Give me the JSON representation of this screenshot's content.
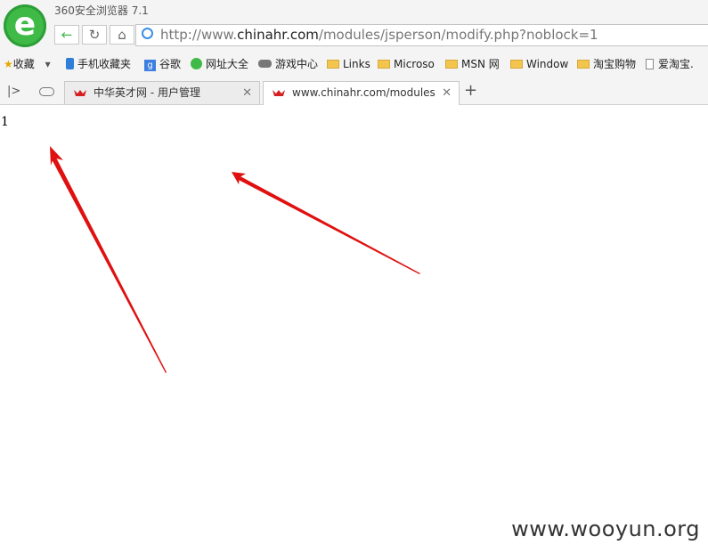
{
  "browser": {
    "title": "360安全浏览器 7.1"
  },
  "nav": {
    "back": "←",
    "reload": "↻",
    "home": "⌂"
  },
  "urlbar": {
    "host_pre": "http://www.",
    "host": "chinahr.com",
    "path": "/modules/jsperson/modify.php?noblock=1"
  },
  "bookmarks": [
    {
      "label": "收藏",
      "icon": "star-icon"
    },
    {
      "label": "手机收藏夹",
      "icon": "phone-icon"
    },
    {
      "label": "谷歌",
      "icon": "google-icon"
    },
    {
      "label": "网址大全",
      "icon": "globe-icon"
    },
    {
      "label": "游戏中心",
      "icon": "gamepad-icon"
    },
    {
      "label": "Links",
      "icon": "folder-icon"
    },
    {
      "label": "Microso",
      "icon": "folder-icon"
    },
    {
      "label": "MSN 网",
      "icon": "folder-icon"
    },
    {
      "label": "Window",
      "icon": "folder-icon"
    },
    {
      "label": "淘宝购物",
      "icon": "folder-icon"
    },
    {
      "label": "爱淘宝.",
      "icon": "page-icon"
    }
  ],
  "tabs": [
    {
      "label": "中华英才网 - 用户管理",
      "active": false
    },
    {
      "label": "www.chinahr.com/modules/js",
      "active": true
    }
  ],
  "tab_new": "+",
  "page": {
    "text": "1"
  },
  "watermark": "www.wooyun.org",
  "colors": {
    "accent": "#3fba47",
    "arrow": "#e01010"
  }
}
